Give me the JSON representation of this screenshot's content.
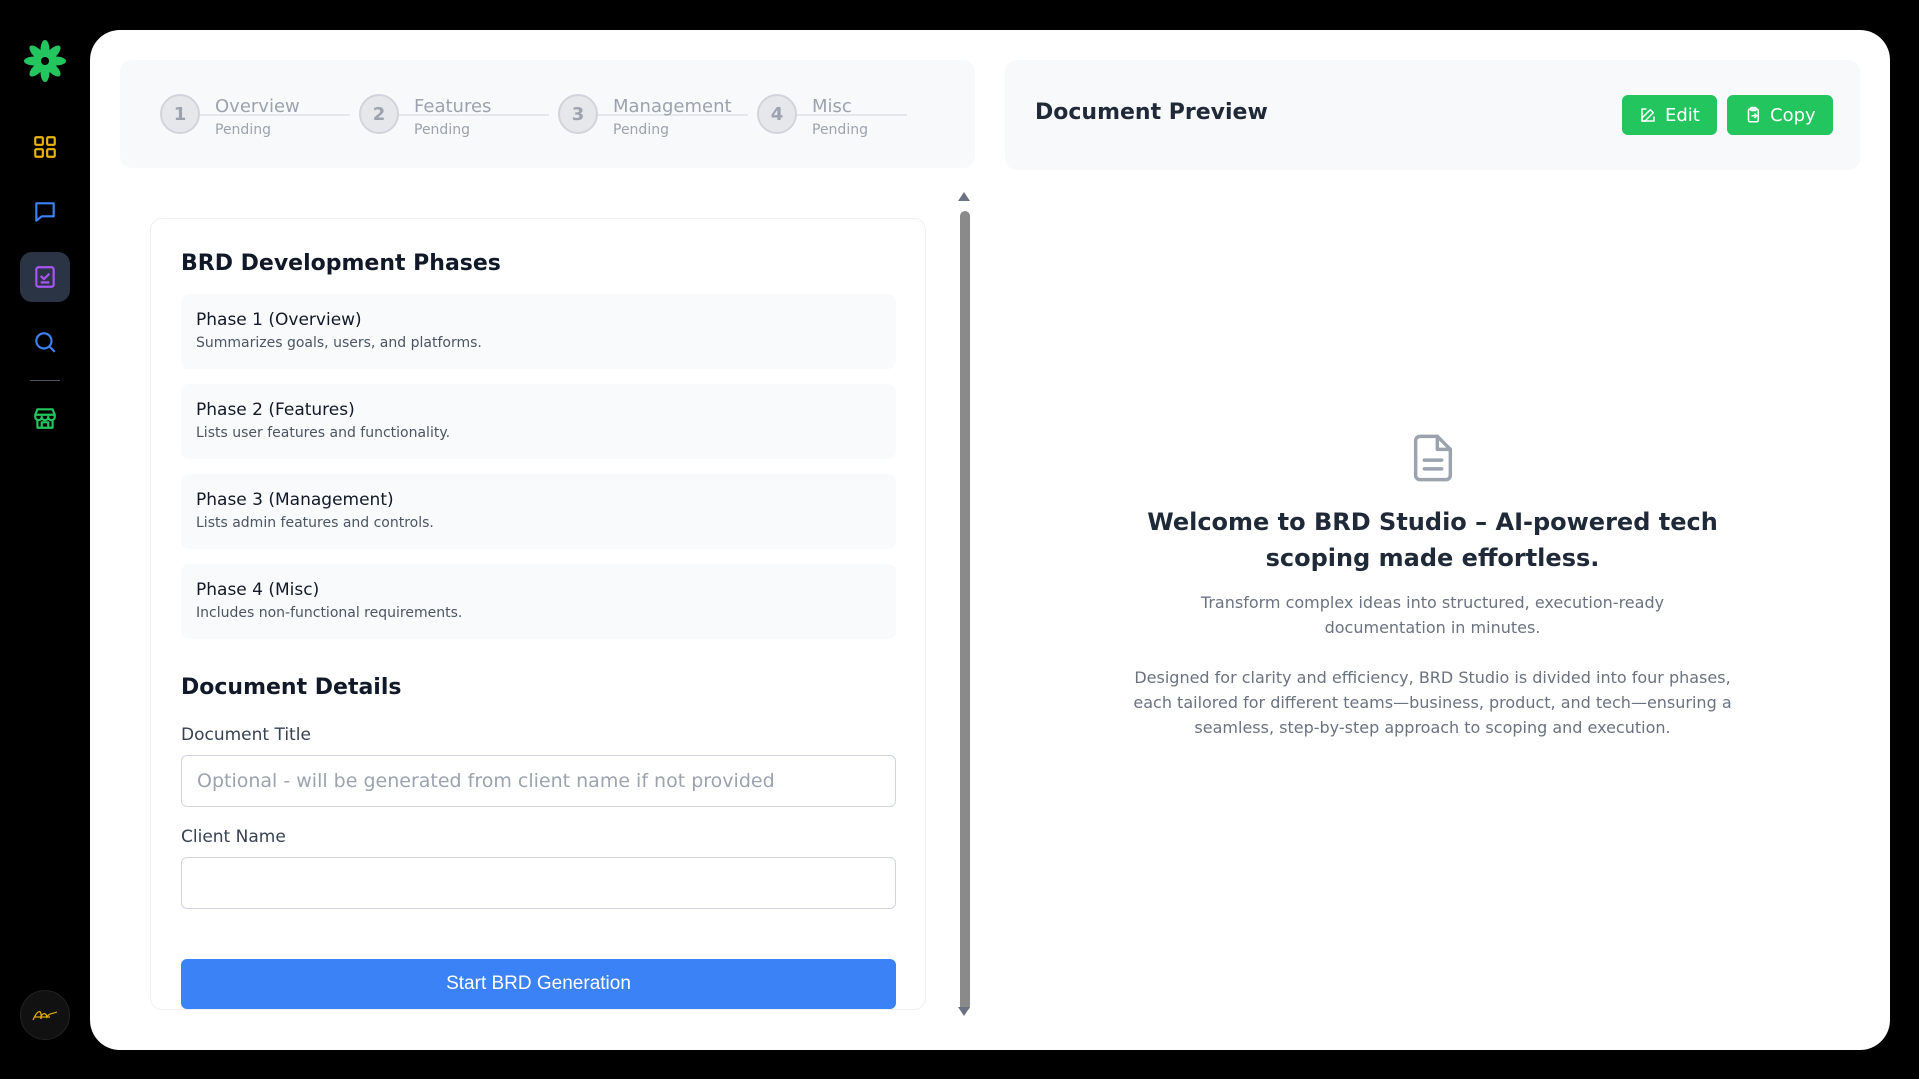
{
  "sidebar": {
    "logo_icon": "flower-logo-icon",
    "items": [
      {
        "name": "dashboard",
        "icon": "grid-icon",
        "color": "#eab308"
      },
      {
        "name": "chat",
        "icon": "message-icon",
        "color": "#3b82f6"
      },
      {
        "name": "brd",
        "icon": "clipboard-check-icon",
        "color": "#a855f7",
        "active": true
      },
      {
        "name": "search",
        "icon": "search-icon",
        "color": "#3b82f6"
      },
      {
        "name": "store",
        "icon": "store-icon",
        "color": "#22c55e"
      }
    ],
    "avatar_icon": "signature-avatar"
  },
  "stepper": {
    "steps": [
      {
        "number": "1",
        "title": "Overview",
        "status": "Pending"
      },
      {
        "number": "2",
        "title": "Features",
        "status": "Pending"
      },
      {
        "number": "3",
        "title": "Management",
        "status": "Pending"
      },
      {
        "number": "4",
        "title": "Misc",
        "status": "Pending"
      }
    ]
  },
  "preview": {
    "title": "Document Preview",
    "edit_label": "Edit",
    "copy_label": "Copy",
    "accent": "#22c55e"
  },
  "form": {
    "phases_title": "BRD Development Phases",
    "phases": [
      {
        "title": "Phase 1 (Overview)",
        "desc": "Summarizes goals, users, and platforms."
      },
      {
        "title": "Phase 2 (Features)",
        "desc": "Lists user features and functionality."
      },
      {
        "title": "Phase 3 (Management)",
        "desc": "Lists admin features and controls."
      },
      {
        "title": "Phase 4 (Misc)",
        "desc": "Includes non-functional requirements."
      }
    ],
    "details_title": "Document Details",
    "doc_title_label": "Document Title",
    "doc_title_placeholder": "Optional - will be generated from client name if not provided",
    "doc_title_value": "",
    "client_label": "Client Name",
    "client_placeholder": "",
    "client_value": "",
    "submit_label": "Start BRD Generation",
    "submit_color": "#3b82f6"
  },
  "welcome": {
    "icon": "file-text-icon",
    "title": "Welcome to BRD Studio – AI-powered tech scoping made effortless.",
    "subtitle": "Transform complex ideas into structured, execution-ready documentation in minutes.",
    "body": "Designed for clarity and efficiency, BRD Studio is divided into four phases, each tailored for different teams—business, product, and tech—ensuring a seamless, step-by-step approach to scoping and execution."
  }
}
